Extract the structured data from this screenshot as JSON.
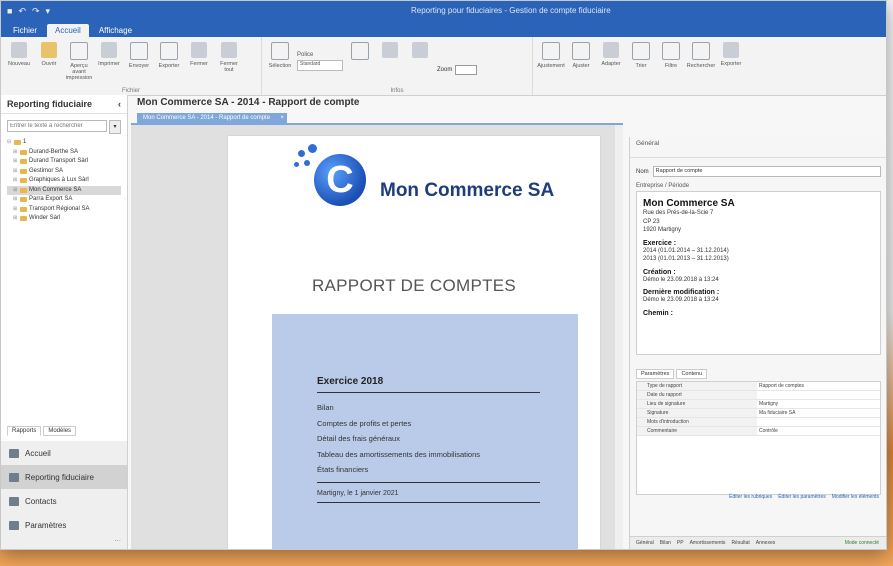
{
  "window": {
    "title": "Reporting pour fiduciaires - Gestion de compte fiduciaire"
  },
  "ribbon": {
    "tabs": [
      "Fichier",
      "Accueil",
      "Affichage"
    ],
    "active_tab": "Accueil",
    "group_label_fichier": "Fichier",
    "group_label_infos": "Infos",
    "buttons": [
      {
        "label": "Nouveau",
        "icon": "new-icon"
      },
      {
        "label": "Ouvrir",
        "icon": "open-folder-icon"
      },
      {
        "label": "Aperçu avant impression",
        "icon": "preview-icon"
      },
      {
        "label": "Imprimer",
        "icon": "print-icon"
      },
      {
        "label": "Envoyer",
        "icon": "send-icon"
      },
      {
        "label": "Exporter",
        "icon": "export-icon"
      },
      {
        "label": "Fermer",
        "icon": "close-doc-icon"
      },
      {
        "label": "Fermer tout",
        "icon": "close-all-icon"
      },
      {
        "label": "Sélection",
        "icon": "select-icon"
      }
    ],
    "style_label": "Police",
    "style_value": "Standard",
    "zoom_label": "Zoom",
    "right_buttons": [
      {
        "label": "Ajustement",
        "icon": "fit-icon"
      },
      {
        "label": "Ajuster",
        "icon": "fit-width-icon"
      },
      {
        "label": "Adapter",
        "icon": "fit-page-icon"
      },
      {
        "label": "Trier",
        "icon": "sort-icon"
      },
      {
        "label": "Filtre",
        "icon": "filter-icon"
      },
      {
        "label": "Rechercher",
        "icon": "search-icon"
      },
      {
        "label": "Exporter",
        "icon": "export-icon"
      }
    ]
  },
  "left": {
    "header": "Reporting fiduciaire",
    "search_placeholder": "Entrer le texte à rechercher",
    "tree": [
      {
        "label": "1",
        "level": 0
      },
      {
        "label": "Durand-Berthe SA",
        "level": 1
      },
      {
        "label": "Durand Transport Sàrl",
        "level": 1
      },
      {
        "label": "Gestimor SA",
        "level": 1
      },
      {
        "label": "Graphiques à Lux Sàrl",
        "level": 1
      },
      {
        "label": "Mon Commerce SA",
        "level": 1,
        "selected": true
      },
      {
        "label": "Parra Export SA",
        "level": 1
      },
      {
        "label": "Transport Régional SA",
        "level": 1
      },
      {
        "label": "Winder Sàrl",
        "level": 1
      }
    ],
    "tabs": [
      "Rapports",
      "Modèles"
    ],
    "nav": [
      {
        "label": "Accueil",
        "icon": "home-icon"
      },
      {
        "label": "Reporting fiduciaire",
        "icon": "report-icon",
        "selected": true
      },
      {
        "label": "Contacts",
        "icon": "contacts-icon"
      },
      {
        "label": "Paramètres",
        "icon": "settings-icon"
      }
    ],
    "more": "..."
  },
  "document": {
    "title": "Mon Commerce SA - 2014 - Rapport de compte",
    "tab_label": "Mon Commerce SA - 2014 - Rapport de compte",
    "tab_close": "×",
    "logo_letter": "C",
    "company": "Mon Commerce SA",
    "heading": "RAPPORT DE COMPTES",
    "exercise_title": "Exercice 2018",
    "items": [
      "Bilan",
      "Comptes de profits et pertes",
      "Détail des frais généraux",
      "Tableau des amortissements des immobilisations",
      "États financiers"
    ],
    "place_date": "Martigny, le 1 janvier 2021"
  },
  "right": {
    "title": "Général",
    "name_label": "Nom",
    "name_value": "Rapport de compte",
    "section": "Entreprise / Période",
    "card": {
      "company": "Mon Commerce SA",
      "address": [
        "Rue des Prés-de-la-Scie 7",
        "CP 23",
        "1920 Martigny"
      ],
      "exercise_head": "Exercice :",
      "exercises": [
        "2014 (01.01.2014 – 31.12.2014)",
        "2013 (01.01.2013 – 31.12.2013)"
      ],
      "creation_head": "Création :",
      "creation": "Démo le 23.09.2018 à 13:24",
      "modified_head": "Dernière modification :",
      "modified": "Démo le 23.09.2018 à 13:24",
      "path_head": "Chemin :"
    },
    "tabs": [
      "Paramètres",
      "Contenu"
    ],
    "grid": [
      {
        "k": "Type de rapport",
        "v": "Rapport de comptes"
      },
      {
        "k": "Date du rapport",
        "v": ""
      },
      {
        "k": "Lieu de signature",
        "v": "Martigny"
      },
      {
        "k": "Signature",
        "v": "Ma fiduciaire SA"
      },
      {
        "k": "Mots d'introduction",
        "v": ""
      },
      {
        "k": "Commentaire",
        "v": "Contrôle"
      }
    ],
    "links": [
      "Éditer les rubriques",
      "Éditer les paramètres",
      "Modifier les éléments"
    ],
    "status_items": [
      "Général",
      "Bilan",
      "PP",
      "Amortissements",
      "Résultat",
      "Annexes"
    ],
    "status_ok": "Mode connecté"
  }
}
